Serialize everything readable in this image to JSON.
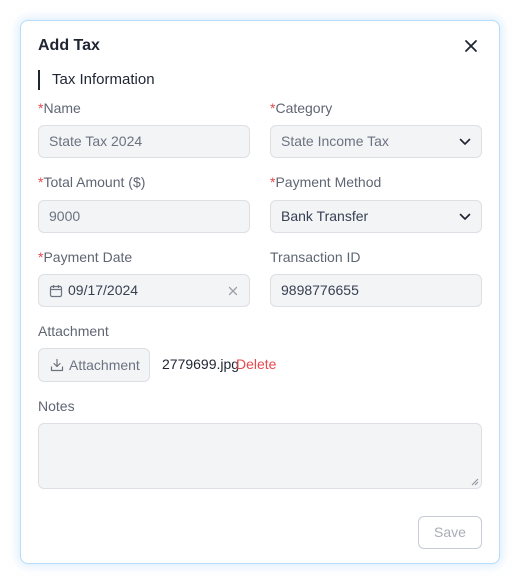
{
  "dialog": {
    "title": "Add Tax",
    "section_title": "Tax Information"
  },
  "form": {
    "name": {
      "label": "Name",
      "required": "*",
      "value": "State Tax 2024"
    },
    "category": {
      "label": "Category",
      "required": "*",
      "value": "State Income Tax"
    },
    "total_amount": {
      "label": "Total Amount ($)",
      "required": "*",
      "value": "9000"
    },
    "payment_method": {
      "label": "Payment Method",
      "required": "*",
      "value": "Bank Transfer"
    },
    "payment_date": {
      "label": "Payment Date",
      "required": "*",
      "value": "09/17/2024"
    },
    "transaction_id": {
      "label": "Transaction ID",
      "value": "9898776655"
    },
    "attachment": {
      "label": "Attachment",
      "button_label": "Attachment",
      "file_name": "2779699.jpg",
      "delete_label": "Delete"
    },
    "notes": {
      "label": "Notes",
      "value": ""
    }
  },
  "actions": {
    "save_label": "Save"
  },
  "icons": [
    "close-icon",
    "chevron-down-icon",
    "calendar-icon",
    "clear-icon",
    "upload-icon",
    "resize-grip-icon"
  ],
  "colors": {
    "required": "#e5484d",
    "delete": "#e5484d",
    "dialog_border": "#b9dcfb"
  }
}
